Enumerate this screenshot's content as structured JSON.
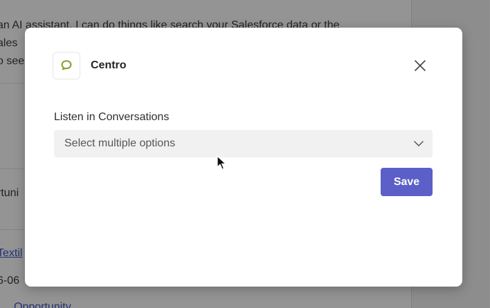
{
  "background": {
    "assistant_intro_line1": "an AI assistant. I can do things like search your Salesforce data or the",
    "assistant_intro_line2": "ales",
    "assistant_intro_line3": "o see",
    "opportunity_label": "rtuni",
    "account_link": "Textil",
    "date_fragment": "6-06",
    "opportunity_link": "Opportunity"
  },
  "modal": {
    "app": {
      "name": "Centro",
      "logo_icon": "speech-bubble-icon",
      "logo_color": "#8aa63a"
    },
    "close_icon": "close-icon",
    "field": {
      "label": "Listen in Conversations",
      "placeholder": "Select multiple options",
      "chevron_icon": "chevron-down-icon"
    },
    "save_label": "Save",
    "accent_color": "#5b5fc7"
  }
}
